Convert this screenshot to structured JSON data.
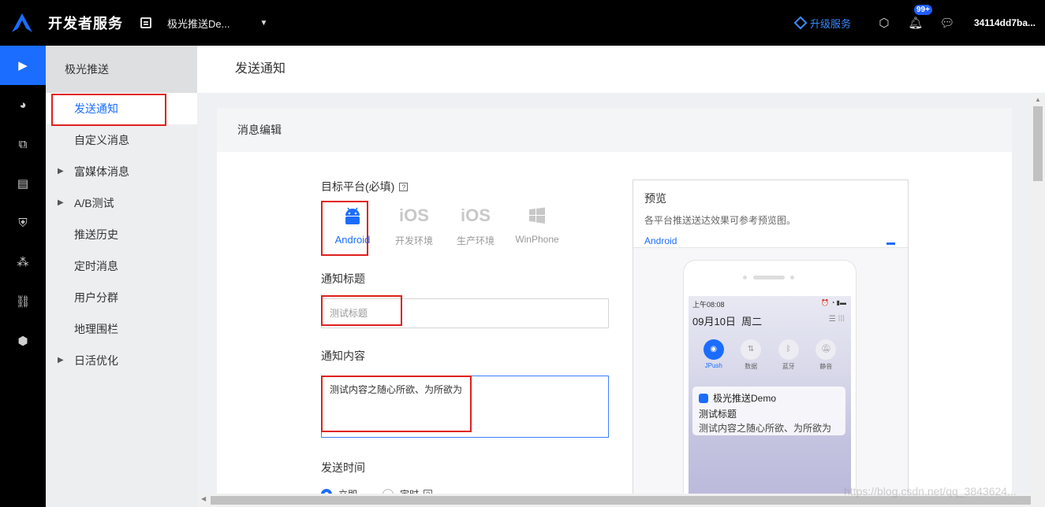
{
  "header": {
    "brand": "开发者服务",
    "app_name": "极光推送De...",
    "upgrade": "升级服务",
    "notification_badge": "99+",
    "user": "34114dd7ba..."
  },
  "submenu": {
    "title": "极光推送",
    "items": [
      {
        "label": "发送通知"
      },
      {
        "label": "自定义消息"
      },
      {
        "label": "富媒体消息"
      },
      {
        "label": "A/B测试"
      },
      {
        "label": "推送历史"
      },
      {
        "label": "定时消息"
      },
      {
        "label": "用户分群"
      },
      {
        "label": "地理围栏"
      },
      {
        "label": "日活优化"
      }
    ]
  },
  "page": {
    "title": "发送通知",
    "section": "消息编辑"
  },
  "form": {
    "target_platform_label": "目标平台(必填)",
    "platforms": [
      {
        "label": "Android"
      },
      {
        "label": "开发环境",
        "glyph": "iOS"
      },
      {
        "label": "生产环境",
        "glyph": "iOS"
      },
      {
        "label": "WinPhone"
      }
    ],
    "title_label": "通知标题",
    "title_value": "测试标题",
    "content_label": "通知内容",
    "content_value": "测试内容之随心所欲、为所欲为",
    "send_time_label": "发送时间",
    "send_now": "立即",
    "send_scheduled": "定时"
  },
  "preview": {
    "title": "预览",
    "subtitle": "各平台推送送达效果可参考预览图。",
    "tab": "Android",
    "status_time": "上午08:08",
    "date": "09月10日",
    "weekday": "周二",
    "quick_settings": [
      {
        "label": "JPush"
      },
      {
        "label": "数据"
      },
      {
        "label": "蓝牙"
      },
      {
        "label": "静音"
      }
    ],
    "notification_app": "极光推送Demo",
    "notification_title": "测试标题",
    "notification_body": "测试内容之随心所欲、为所欲为"
  },
  "watermark": "https://blog.csdn.net/qq_3843624..."
}
